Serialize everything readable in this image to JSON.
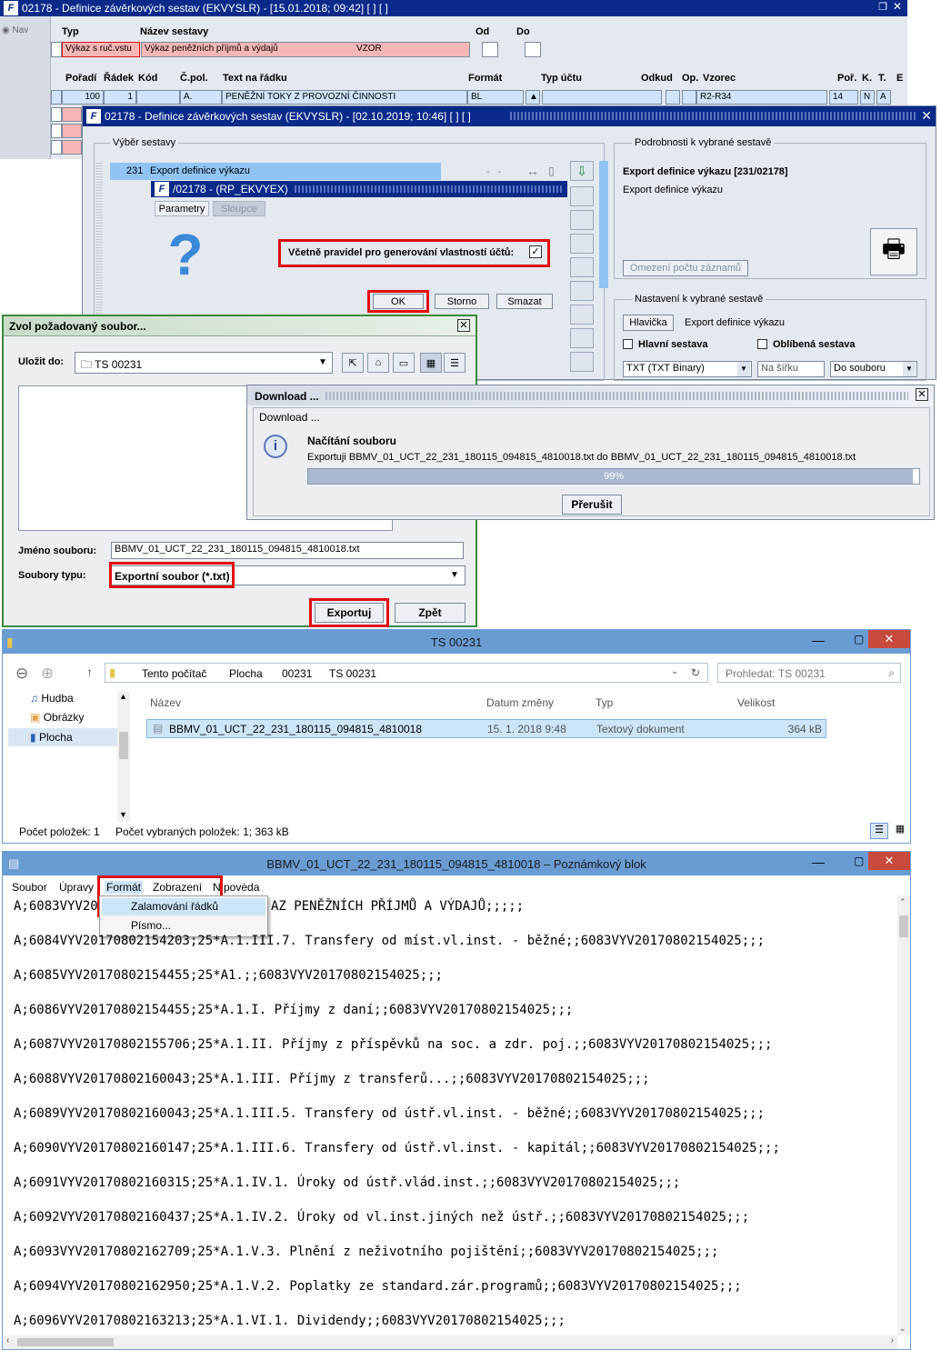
{
  "win1": {
    "title": "02178 - Definice závěrkových sestav (EKVYSLR) - [15.01.2018; 09:42]  [ ]  [ ]",
    "nav": "Nav",
    "headers": {
      "typ": "Typ",
      "nazev": "Název sestavy",
      "od": "Od",
      "do": "Do"
    },
    "typ_value": "Výkaz s ruč.vstu",
    "nazev_value": "Výkaz peněžních příjmů a výdajů",
    "vzor": "VZOR",
    "cols": [
      "Pořadí",
      "Řádek",
      "Kód",
      "Č.pol.",
      "Text na řádku",
      "Formát",
      "Typ účtu",
      "Odkud",
      "Op.",
      "Vzorec",
      "Poř.",
      "K.",
      "T.",
      "E"
    ],
    "row": {
      "poradi": "100",
      "radek": "1",
      "cpol": "A.",
      "text": "PENĚŽNÍ TOKY Z PROVOZNÍ ČINNOSTI",
      "format": "BL",
      "vzorec": "R2-R34",
      "por": "14",
      "k": "N",
      "t": "A"
    }
  },
  "win2": {
    "title": "02178 - Definice závěrkových sestav (EKVYSLR) - [02.10.2019; 10:46]  [ ]  [ ]",
    "vyber_label": "Výběr sestavy",
    "selected_num": "231",
    "selected_name": "Export definice výkazu",
    "podrobnosti_label": "Podrobnosti k vybrané sestavě",
    "detail_title": "Export definice výkazu [231/02178]",
    "detail_sub": "Export definice výkazu",
    "omezeni": "Omezení počtu záznamů",
    "nastaveni_label": "Nastavení k vybrané sestavě",
    "hlavicka_btn": "Hlavička",
    "hlavicka_text": "Export definice výkazu",
    "hlavni": "Hlavní sestava",
    "oblibena": "Oblíbená sestava",
    "sel1": "TXT (TXT Binary)",
    "sel2": "Na šířku",
    "sel3": "Do souboru"
  },
  "win3": {
    "title": "/02178 - (RP_EKVYEX)",
    "tab1": "Parametry",
    "tab2": "Sloupce",
    "check_label": "Včetně pravidel pro generování vlastností účtů:",
    "ok": "OK",
    "storno": "Storno",
    "smazat": "Smazat"
  },
  "save": {
    "title": "Zvol požadovaný soubor...",
    "ulozit_label": "Uložit do:",
    "folder": "TS 00231",
    "jmeno_label": "Jméno souboru:",
    "jmeno_value": "BBMV_01_UCT_22_231_180115_094815_4810018.txt",
    "typy_label": "Soubory typu:",
    "typy_value": "Exportní soubor (*.txt)",
    "exportuj": "Exportuj",
    "zpet": "Zpět"
  },
  "download": {
    "title": "Download ...",
    "sub": "Download ...",
    "heading": "Načítání souboru",
    "message": "Exportuji BBMV_01_UCT_22_231_180115_094815_4810018.txt do BBMV_01_UCT_22_231_180115_094815_4810018.txt",
    "progress_text": "99%",
    "progress": 0.99,
    "cancel": "Přerušit"
  },
  "explorer": {
    "title": "TS 00231",
    "path": [
      "Tento počítač",
      "Plocha",
      "00231",
      "TS 00231"
    ],
    "search": "Prohledat: TS 00231",
    "nav_items": [
      "Hudba",
      "Obrázky",
      "Plocha"
    ],
    "cols": [
      "Název",
      "Datum změny",
      "Typ",
      "Velikost"
    ],
    "file": {
      "name": "BBMV_01_UCT_22_231_180115_094815_4810018",
      "date": "15. 1. 2018 9:48",
      "type": "Textový dokument",
      "size": "364 kB"
    },
    "status1": "Počet položek: 1",
    "status2": "Počet vybraných položek: 1; 363 kB"
  },
  "notepad": {
    "title": "BBMV_01_UCT_22_231_180115_094815_4810018 – Poznámkový blok",
    "menu": [
      "Soubor",
      "Úpravy",
      "Formát",
      "Zobrazení",
      "Nápověda"
    ],
    "menu_vis": "N povėda",
    "dropdown": [
      "Zalamování řádků",
      "Písmo..."
    ],
    "first_left": "A;6083VYV20",
    "first_right": "AZ PENĚŽNÍCH PŘÍJMŮ A VÝDAJŮ;;;;;",
    "lines": [
      "A;6084VYV20170802154203;25*A.1.III.7. Transfery od míst.vl.inst. - běžné;;6083VYV20170802154025;;;",
      "A;6085VYV20170802154455;25*A1.;;6083VYV20170802154025;;;",
      "A;6086VYV20170802154455;25*A.1.I. Příjmy z daní;;6083VYV20170802154025;;;",
      "A;6087VYV20170802155706;25*A.1.II. Příjmy z příspěvků na soc. a zdr. poj.;;6083VYV20170802154025;;;",
      "A;6088VYV20170802160043;25*A.1.III. Příjmy z transferů...;;6083VYV20170802154025;;;",
      "A;6089VYV20170802160043;25*A.1.III.5. Transfery od ústř.vl.inst. - běžné;;6083VYV20170802154025;;;",
      "A;6090VYV20170802160147;25*A.1.III.6. Transfery od ústř.vl.inst. - kapitál;;6083VYV20170802154025;;;",
      "A;6091VYV20170802160315;25*A.1.IV.1. Úroky od ústř.vlád.inst.;;6083VYV20170802154025;;;",
      "A;6092VYV20170802160437;25*A.1.IV.2. Úroky od vl.inst.jiných než ústř.;;6083VYV20170802154025;;;",
      "A;6093VYV20170802162709;25*A.1.V.3. Plnění z neživotního pojištění;;6083VYV20170802154025;;;",
      "A;6094VYV20170802162950;25*A.1.V.2. Poplatky ze standard.zár.programů;;6083VYV20170802154025;;;",
      "A;6096VYV20170802163213;25*A.1.VI.1. Dividendy;;6083VYV20170802154025;;;"
    ]
  }
}
